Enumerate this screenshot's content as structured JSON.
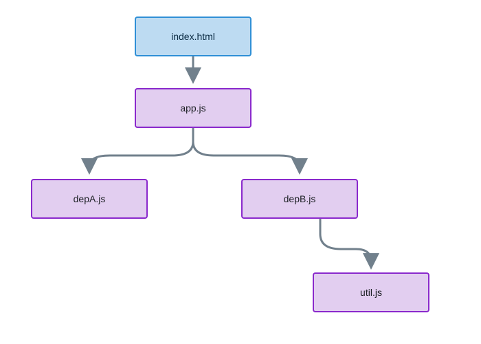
{
  "nodes": {
    "index": {
      "label": "index.html"
    },
    "app": {
      "label": "app.js"
    },
    "depA": {
      "label": "depA.js"
    },
    "depB": {
      "label": "depB.js"
    },
    "util": {
      "label": "util.js"
    }
  },
  "colors": {
    "root_fill": "#bddbf2",
    "root_border": "#2f8fd6",
    "dep_fill": "#e2cef0",
    "dep_border": "#8a29cc",
    "arrow": "#71808c"
  }
}
